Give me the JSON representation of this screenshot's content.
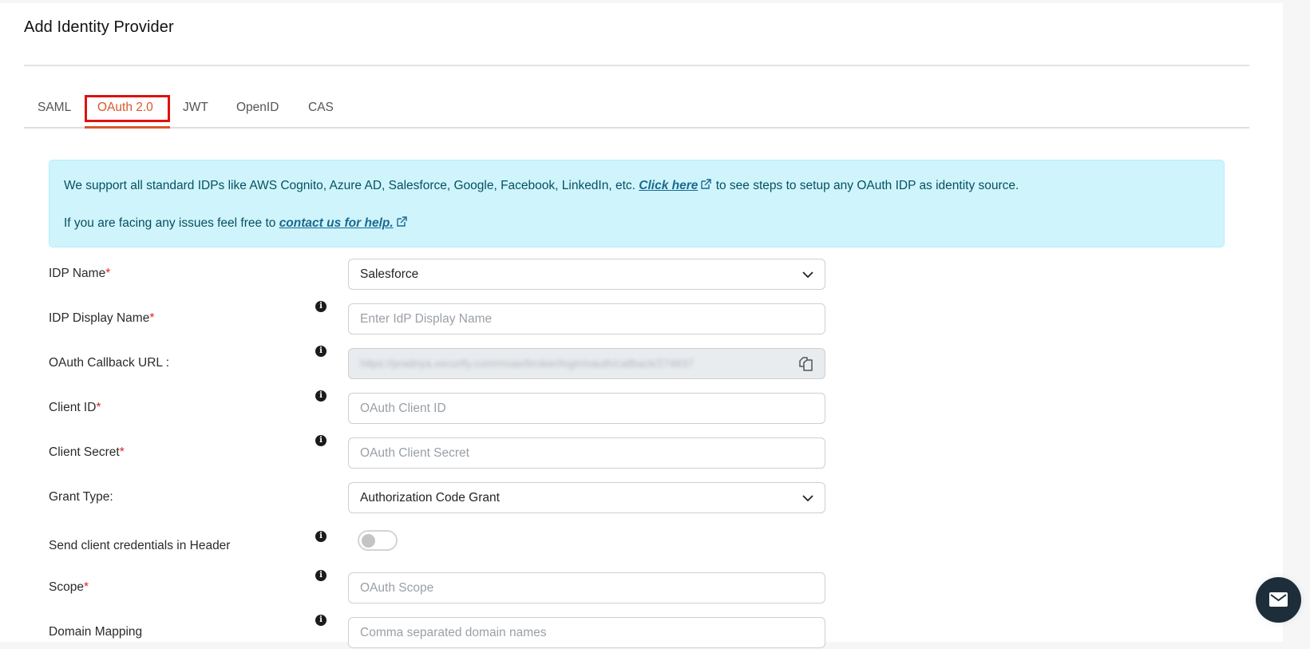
{
  "page": {
    "title": "Add Identity Provider"
  },
  "tabs": [
    {
      "label": "SAML",
      "active": false
    },
    {
      "label": "OAuth 2.0",
      "active": true
    },
    {
      "label": "JWT",
      "active": false
    },
    {
      "label": "OpenID",
      "active": false
    },
    {
      "label": "CAS",
      "active": false
    }
  ],
  "alert": {
    "line1_prefix": "We support all standard IDPs like AWS Cognito, Azure AD, Salesforce, Google, Facebook, LinkedIn, etc.",
    "line1_link": "Click here",
    "line1_suffix": "to see steps to setup any OAuth IDP as identity source.",
    "line2_prefix": "If you are facing any issues feel free to",
    "line2_link": "contact us for help."
  },
  "form": {
    "idp_name": {
      "label": "IDP Name",
      "required": "*",
      "value": "Salesforce"
    },
    "idp_display_name": {
      "label": "IDP Display Name",
      "required": "*",
      "placeholder": "Enter IdP Display Name",
      "value": ""
    },
    "callback_url": {
      "label": "OAuth Callback URL :",
      "value": "https://pradnya.xecurify.com/moas/broker/login/oauth/callback/274837"
    },
    "client_id": {
      "label": "Client ID",
      "required": "*",
      "placeholder": "OAuth Client ID",
      "value": ""
    },
    "client_secret": {
      "label": "Client Secret",
      "required": "*",
      "placeholder": "OAuth Client Secret",
      "value": ""
    },
    "grant_type": {
      "label": "Grant Type:",
      "value": "Authorization Code Grant"
    },
    "send_credentials_header": {
      "label": "Send client credentials in Header",
      "enabled": false
    },
    "scope": {
      "label": "Scope",
      "required": "*",
      "placeholder": "OAuth Scope",
      "value": ""
    },
    "domain_mapping": {
      "label": "Domain Mapping",
      "placeholder": "Comma separated domain names",
      "value": ""
    }
  },
  "colors": {
    "accent": "#d9582b",
    "highlight_box": "#e01010",
    "alert_bg": "#cff4fc",
    "alert_text": "#055160",
    "required": "#e0212d",
    "chat_button": "#1d2e3a"
  },
  "icons": {
    "info": "info-icon",
    "chevron": "chevron-down-icon",
    "copy": "copy-icon",
    "external_link": "external-link-icon",
    "chat": "mail-icon"
  }
}
